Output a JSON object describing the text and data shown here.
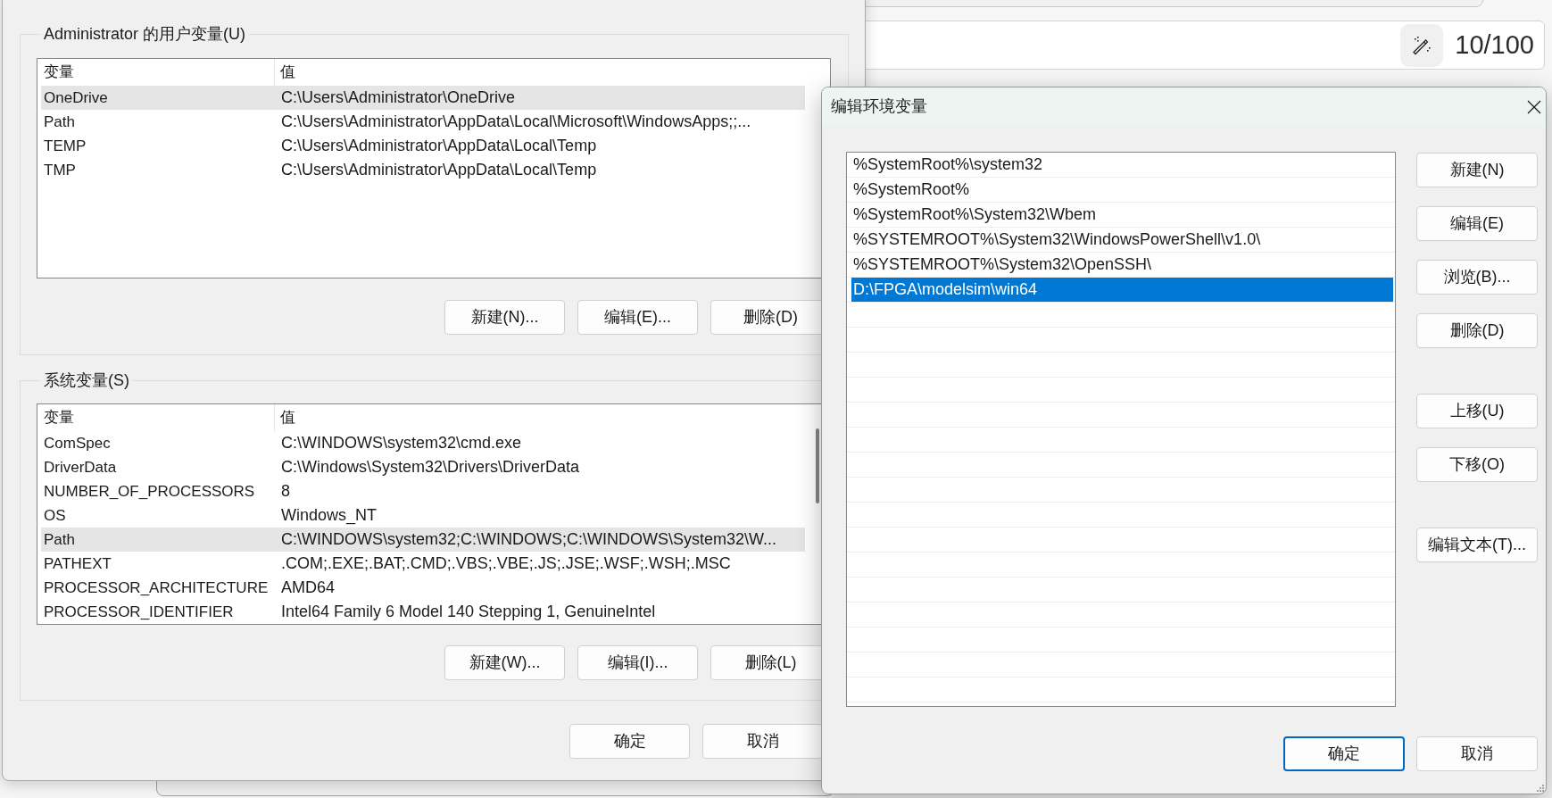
{
  "background_page": {
    "counter": "10/100"
  },
  "environment_variables_dialog": {
    "user_variables": {
      "title": "Administrator 的用户变量(U)",
      "columns": [
        "变量",
        "值"
      ],
      "rows": [
        {
          "name": "OneDrive",
          "value": "C:\\Users\\Administrator\\OneDrive",
          "selected": true
        },
        {
          "name": "Path",
          "value": "C:\\Users\\Administrator\\AppData\\Local\\Microsoft\\WindowsApps;;...",
          "selected": false
        },
        {
          "name": "TEMP",
          "value": "C:\\Users\\Administrator\\AppData\\Local\\Temp",
          "selected": false
        },
        {
          "name": "TMP",
          "value": "C:\\Users\\Administrator\\AppData\\Local\\Temp",
          "selected": false
        }
      ],
      "buttons": [
        "新建(N)...",
        "编辑(E)...",
        "删除(D)"
      ]
    },
    "system_variables": {
      "title": "系统变量(S)",
      "columns": [
        "变量",
        "值"
      ],
      "scrollbar": true,
      "rows": [
        {
          "name": "ComSpec",
          "value": "C:\\WINDOWS\\system32\\cmd.exe",
          "selected": false
        },
        {
          "name": "DriverData",
          "value": "C:\\Windows\\System32\\Drivers\\DriverData",
          "selected": false
        },
        {
          "name": "NUMBER_OF_PROCESSORS",
          "value": "8",
          "selected": false
        },
        {
          "name": "OS",
          "value": "Windows_NT",
          "selected": false
        },
        {
          "name": "Path",
          "value": "C:\\WINDOWS\\system32;C:\\WINDOWS;C:\\WINDOWS\\System32\\W...",
          "selected": true
        },
        {
          "name": "PATHEXT",
          "value": ".COM;.EXE;.BAT;.CMD;.VBS;.VBE;.JS;.JSE;.WSF;.WSH;.MSC",
          "selected": false
        },
        {
          "name": "PROCESSOR_ARCHITECTURE",
          "value": "AMD64",
          "selected": false
        },
        {
          "name": "PROCESSOR_IDENTIFIER",
          "value": "Intel64 Family 6 Model 140 Stepping 1, GenuineIntel",
          "selected": false
        }
      ],
      "buttons": [
        "新建(W)...",
        "编辑(I)...",
        "删除(L)"
      ]
    },
    "buttons": [
      {
        "label": "确定",
        "default": false
      },
      {
        "label": "取消",
        "default": false
      }
    ]
  },
  "edit_environment_variable_dialog": {
    "title": "编辑环境变量",
    "entries": [
      {
        "text": "%SystemRoot%\\system32",
        "selected": false
      },
      {
        "text": "%SystemRoot%",
        "selected": false
      },
      {
        "text": "%SystemRoot%\\System32\\Wbem",
        "selected": false
      },
      {
        "text": "%SYSTEMROOT%\\System32\\WindowsPowerShell\\v1.0\\",
        "selected": false
      },
      {
        "text": "%SYSTEMROOT%\\System32\\OpenSSH\\",
        "selected": false
      },
      {
        "text": "D:\\FPGA\\modelsim\\win64",
        "selected": true
      }
    ],
    "button_groups": [
      [
        "新建(N)",
        "编辑(E)",
        "浏览(B)...",
        "删除(D)"
      ],
      [
        "上移(U)",
        "下移(O)"
      ],
      [
        "编辑文本(T)..."
      ]
    ],
    "buttons": [
      {
        "label": "确定",
        "default": true
      },
      {
        "label": "取消",
        "default": false
      }
    ]
  }
}
